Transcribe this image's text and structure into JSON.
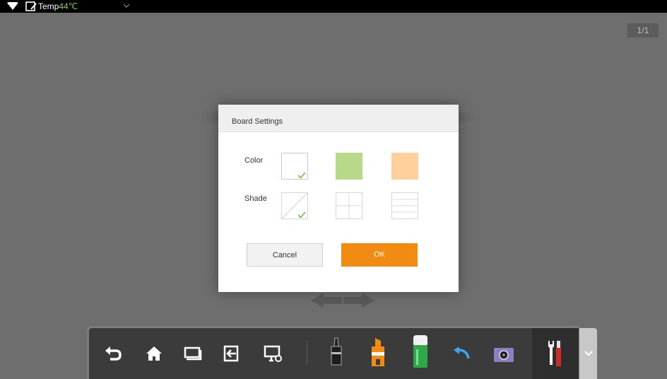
{
  "status_bar": {
    "temp_label": "Temp",
    "temp_value": "44℃",
    "icons": [
      "wifi-icon",
      "board-icon",
      "chevron-down-icon"
    ]
  },
  "page_indicator": "1/1",
  "dialog": {
    "title": "Board Settings",
    "color_label": "Color",
    "shade_label": "Shade",
    "colors": [
      "#ffffff",
      "#b9d98a",
      "#fdd09c"
    ],
    "selected_color_index": 0,
    "shades": [
      "diagonal",
      "grid",
      "lines"
    ],
    "selected_shade_index": 0,
    "cancel_label": "Cancel",
    "ok_label": "OK",
    "accent_color": "#f28b12"
  },
  "toolbar": {
    "items": [
      "undo-icon",
      "home-icon",
      "window-icon",
      "exit-icon",
      "screen-settings-icon",
      "pen-icon",
      "highlighter-icon",
      "eraser-icon",
      "back-icon",
      "camera-icon",
      "tools-icon"
    ],
    "expand_icon": "chevron-down-icon"
  }
}
